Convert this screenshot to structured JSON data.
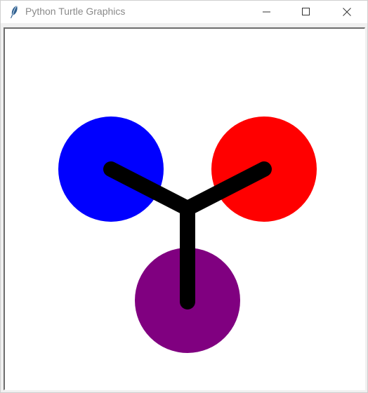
{
  "window": {
    "title": "Python Turtle Graphics",
    "app_icon": "feather-icon",
    "controls": {
      "minimize_icon": "minimize-icon",
      "maximize_icon": "maximize-icon",
      "close_icon": "close-icon"
    }
  },
  "drawing": {
    "circles": [
      {
        "name": "blue",
        "color": "#0000ff"
      },
      {
        "name": "red",
        "color": "#ff0000"
      },
      {
        "name": "purple",
        "color": "#800080"
      }
    ],
    "connector_color": "#000000"
  }
}
